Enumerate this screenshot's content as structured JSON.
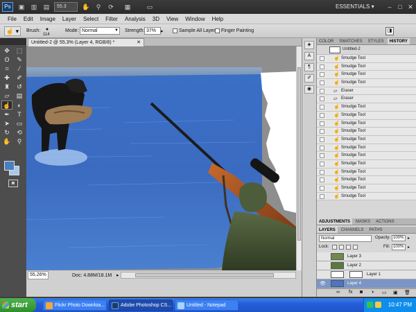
{
  "app": {
    "logo": "Ps",
    "zoom_value": "55.3",
    "workspace": "ESSENTIALS",
    "appbar_icons": [
      "bridge-icon",
      "minibridge-icon",
      "hand-icon",
      "zoom-icon",
      "rotate-icon",
      "arrange-icon",
      "screen-mode-icon"
    ],
    "window_controls": [
      "minimize",
      "maximize",
      "close"
    ]
  },
  "menu": [
    "File",
    "Edit",
    "Image",
    "Layer",
    "Select",
    "Filter",
    "Analysis",
    "3D",
    "View",
    "Window",
    "Help"
  ],
  "options_bar": {
    "brush_label": "Brush:",
    "brush_size": "114",
    "mode_label": "Mode:",
    "mode_value": "Normal",
    "strength_label": "Strength:",
    "strength_value": "37%",
    "sample_all_layers": "Sample All Layers",
    "sample_checked": false,
    "finger_painting": "Finger Painting",
    "finger_checked": false
  },
  "document": {
    "tab_title": "Untitled-2 @ 55.3% (Layer 4, RGB/8) *",
    "zoom": "55.26%",
    "doc_info": "Doc: 4.88M/18.1M"
  },
  "colors": {
    "foreground": "#4a7fbd",
    "background": "#a8c8ef",
    "selected_layer": "#7b95c4"
  },
  "panels": {
    "top_tabs": [
      "COLOR",
      "SWATCHES",
      "STYLES",
      "HISTORY"
    ],
    "history_snapshot": "Untitled-2",
    "history_items": [
      {
        "icon": "smudge-icon",
        "label": "Smudge Tool"
      },
      {
        "icon": "smudge-icon",
        "label": "Smudge Tool"
      },
      {
        "icon": "smudge-icon",
        "label": "Smudge Tool"
      },
      {
        "icon": "smudge-icon",
        "label": "Smudge Tool"
      },
      {
        "icon": "eraser-icon",
        "label": "Eraser"
      },
      {
        "icon": "eraser-icon",
        "label": "Eraser"
      },
      {
        "icon": "smudge-icon",
        "label": "Smudge Tool"
      },
      {
        "icon": "smudge-icon",
        "label": "Smudge Tool"
      },
      {
        "icon": "smudge-icon",
        "label": "Smudge Tool"
      },
      {
        "icon": "smudge-icon",
        "label": "Smudge Tool"
      },
      {
        "icon": "smudge-icon",
        "label": "Smudge Tool"
      },
      {
        "icon": "smudge-icon",
        "label": "Smudge Tool"
      },
      {
        "icon": "smudge-icon",
        "label": "Smudge Tool"
      },
      {
        "icon": "smudge-icon",
        "label": "Smudge Tool"
      },
      {
        "icon": "smudge-icon",
        "label": "Smudge Tool"
      },
      {
        "icon": "smudge-icon",
        "label": "Smudge Tool"
      },
      {
        "icon": "smudge-icon",
        "label": "Smudge Tool"
      },
      {
        "icon": "smudge-icon",
        "label": "Smudge Tool"
      }
    ],
    "adjustment_tabs": [
      "ADJUSTMENTS",
      "MASKS",
      "ACTIONS"
    ],
    "layer_tabs": [
      "LAYERS",
      "CHANNELS",
      "PATHS"
    ],
    "layers": {
      "blend_mode": "Normal",
      "opacity_label": "Opacity:",
      "opacity_value": "100%",
      "lock_label": "Lock:",
      "fill_label": "Fill:",
      "fill_value": "100%",
      "items": [
        {
          "name": "Layer 3",
          "visible": false,
          "selected": false,
          "mask": false
        },
        {
          "name": "Layer 2",
          "visible": false,
          "selected": false,
          "mask": false
        },
        {
          "name": "Layer 1",
          "visible": false,
          "selected": false,
          "mask": true
        },
        {
          "name": "Layer 4",
          "visible": true,
          "selected": true,
          "mask": false
        }
      ]
    }
  },
  "taskbar": {
    "start": "start",
    "tasks": [
      {
        "label": "Flickr Photo Downloa...",
        "active": false
      },
      {
        "label": "Adobe Photoshop CS...",
        "active": true
      },
      {
        "label": "Untitled - Notepad",
        "active": false
      }
    ],
    "clock": "10:47 PM"
  }
}
